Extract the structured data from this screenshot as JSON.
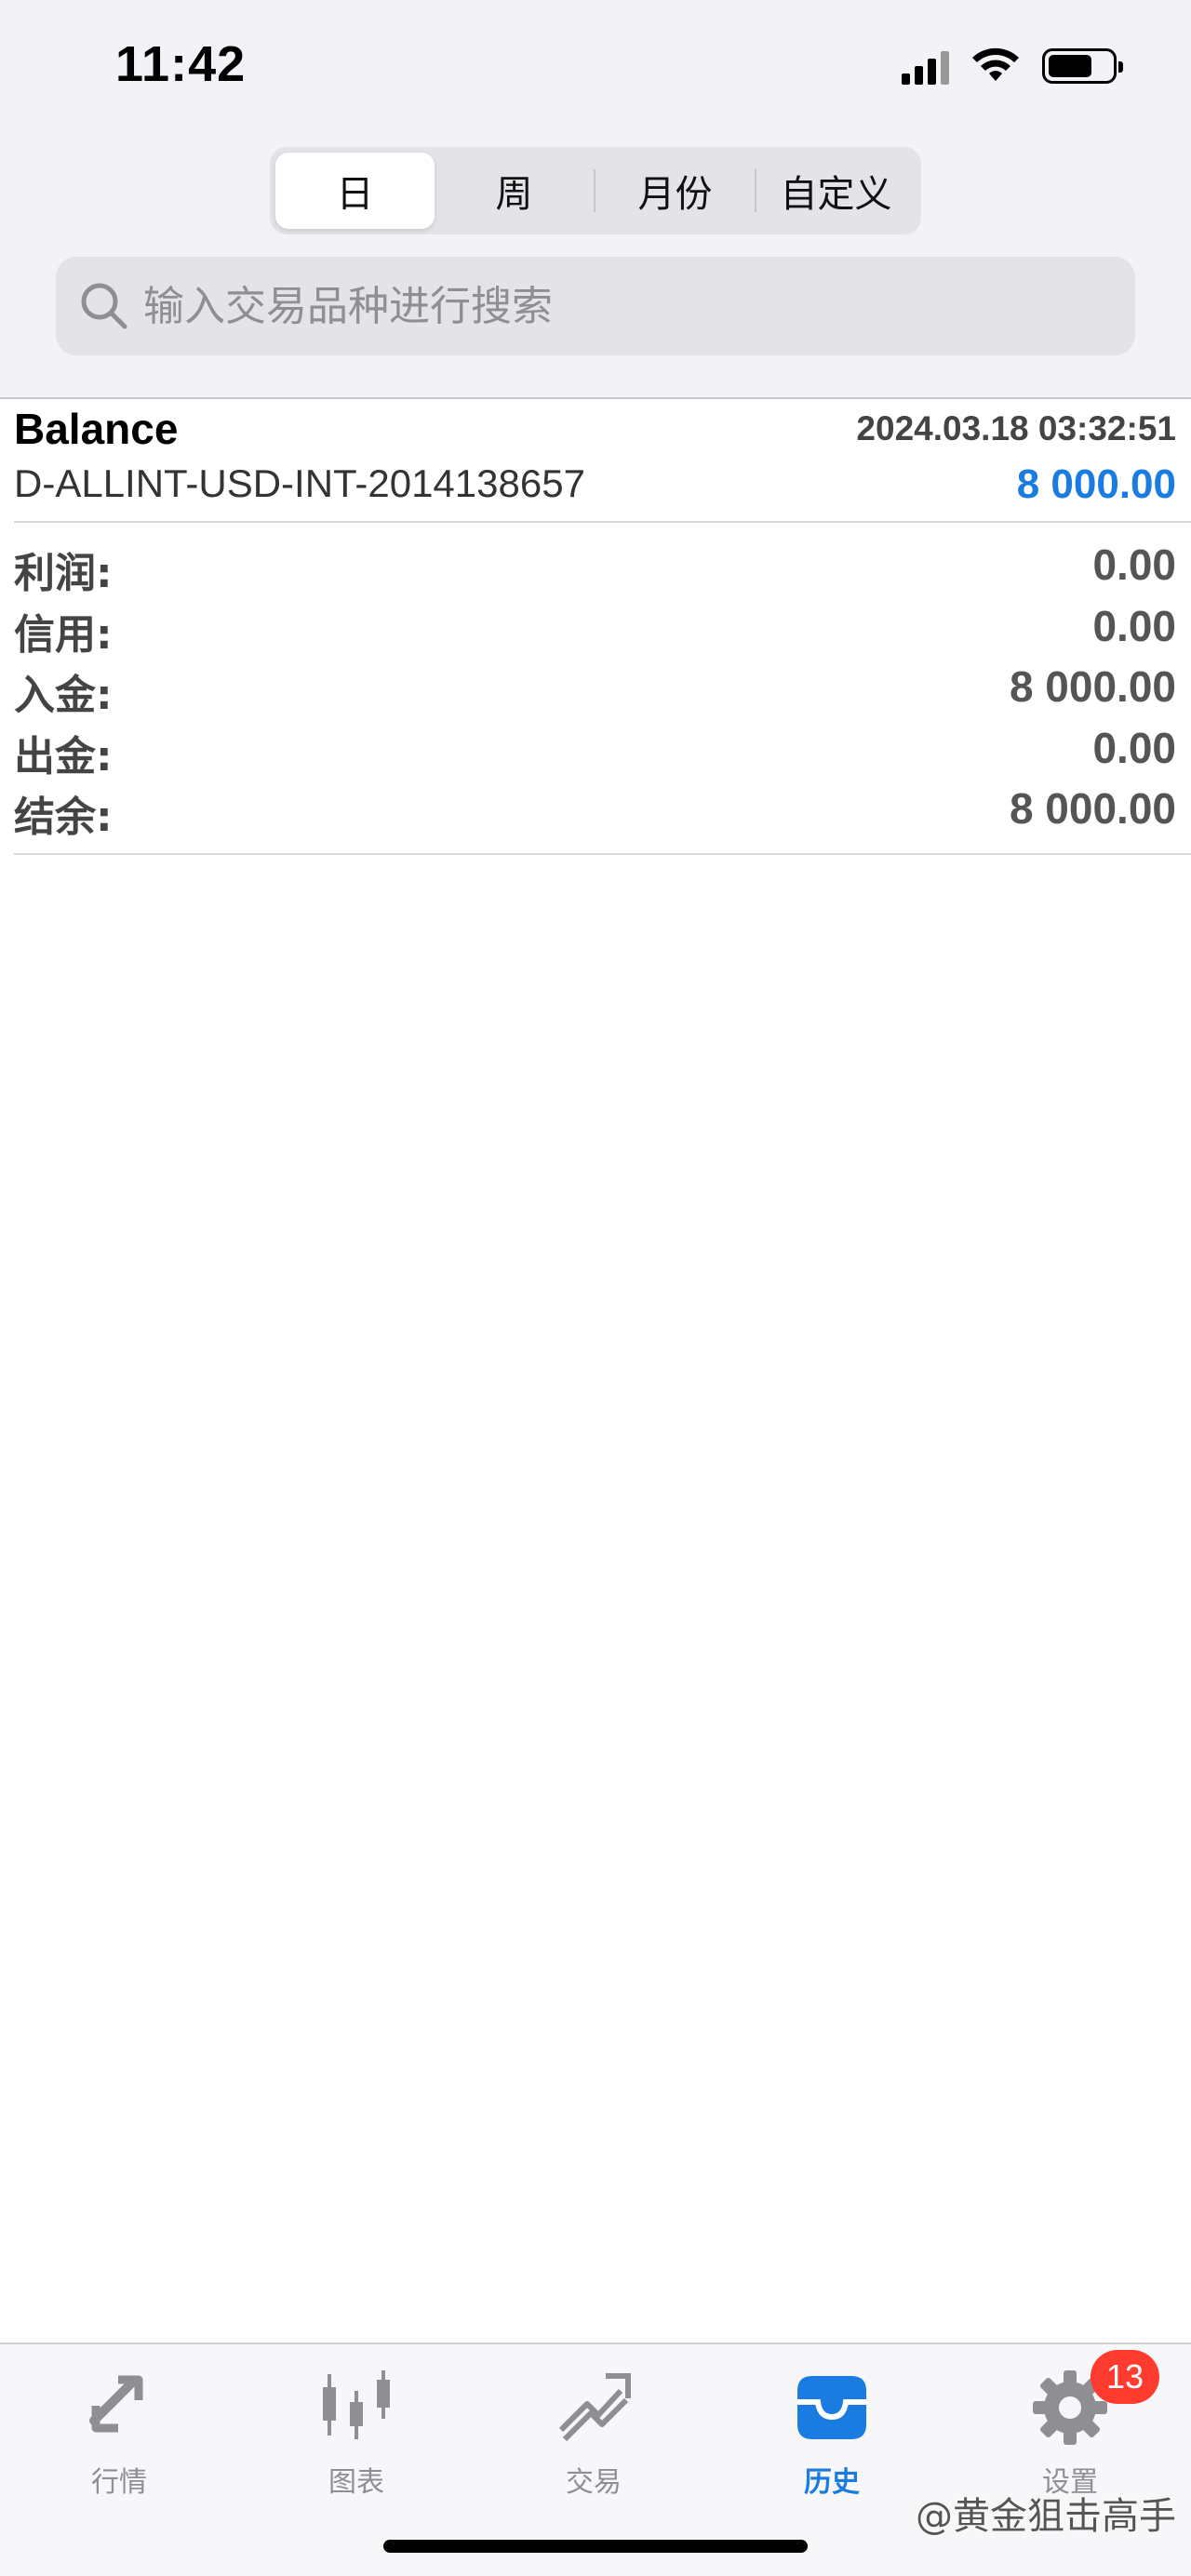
{
  "status_bar": {
    "time": "11:42"
  },
  "period_tabs": [
    {
      "label": "日",
      "active": true
    },
    {
      "label": "周",
      "active": false
    },
    {
      "label": "月份",
      "active": false
    },
    {
      "label": "自定义",
      "active": false
    }
  ],
  "search": {
    "placeholder": "输入交易品种进行搜索"
  },
  "record": {
    "type": "Balance",
    "datetime": "2024.03.18 03:32:51",
    "account": "D-ALLINT-USD-INT-2014138657",
    "amount": "8 000.00",
    "amount_color": "#1a7be0"
  },
  "summary": [
    {
      "label": "利润:",
      "value": "0.00"
    },
    {
      "label": "信用:",
      "value": "0.00"
    },
    {
      "label": "入金:",
      "value": "8 000.00"
    },
    {
      "label": "出金:",
      "value": "0.00"
    },
    {
      "label": "结余:",
      "value": "8 000.00"
    }
  ],
  "tabbar": {
    "items": [
      {
        "label": "行情",
        "icon": "quotes-icon",
        "active": false
      },
      {
        "label": "图表",
        "icon": "candlestick-chart-icon",
        "active": false
      },
      {
        "label": "交易",
        "icon": "trade-icon",
        "active": false
      },
      {
        "label": "历史",
        "icon": "history-inbox-icon",
        "active": true
      },
      {
        "label": "设置",
        "icon": "gear-icon",
        "active": false
      }
    ],
    "settings_badge": "13",
    "accent_color": "#1a7be0",
    "inactive_color": "#8e8e93"
  },
  "watermark": "@黄金狙击高手"
}
